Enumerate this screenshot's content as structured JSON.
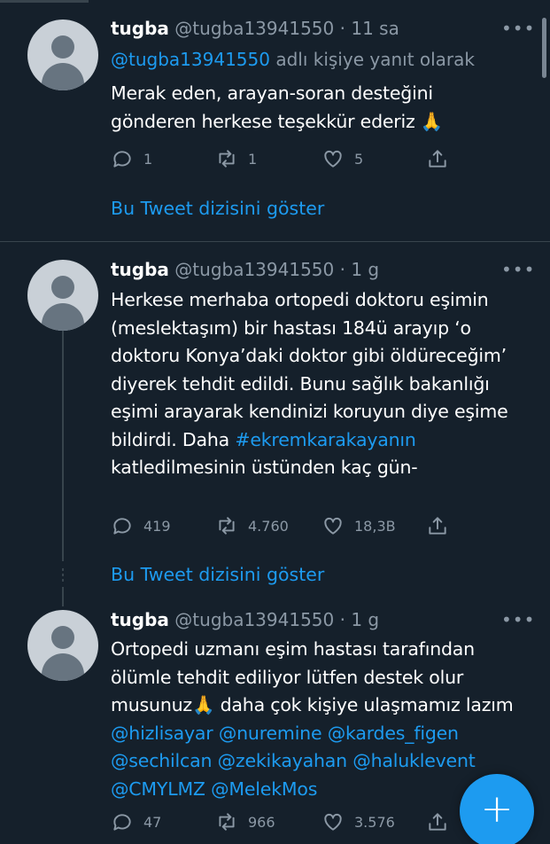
{
  "tweets": [
    {
      "name": "tugba",
      "handle": "@tugba13941550",
      "time": "· 11 sa",
      "reply_handle": "@tugba13941550",
      "reply_suffix": "adlı kişiye yanıt olarak",
      "text_line1": "Merak eden, arayan-soran desteğini",
      "text_line2": "gönderen herkese teşekkür ederiz 🙏",
      "replies": "1",
      "retweets": "1",
      "likes": "5",
      "show_thread": "Bu Tweet dizisini göster"
    },
    {
      "name": "tugba",
      "handle": "@tugba13941550",
      "time": "· 1 g",
      "text_before_hashtag": "Herkese merhaba ortopedi doktoru eşimin (meslektaşım) bir hastası 184ü arayıp ‘o doktoru Konya’daki doktor gibi öldüreceğim’ diyerek tehdit edildi. Bunu sağlık bakanlığı eşimi arayarak kendinizi koruyun diye eşime bildirdi. Daha",
      "hashtag": "#ekremkarakayanın",
      "text_after_hashtag": "katledilmesinin üstünden kaç gün-",
      "replies": "419",
      "retweets": "4.760",
      "likes": "18,3B",
      "show_thread": "Bu Tweet dizisini göster"
    },
    {
      "name": "tugba",
      "handle": "@tugba13941550",
      "time": "· 1 g",
      "text_main": "Ortopedi uzmanı eşim hastası tarafından ölümle tehdit ediliyor lütfen destek olur musunuz🙏 daha çok kişiye ulaşmamız lazım",
      "mentions": [
        "@hizlisayar",
        "@nuremine",
        "@kardes_figen",
        "@sechilcan",
        "@zekikayahan",
        "@haluklevent",
        "@CMYLMZ",
        "@MelekMos"
      ],
      "replies": "47",
      "retweets": "966",
      "likes": "3.576"
    }
  ],
  "icons": {
    "more": "more-horizontal-icon",
    "reply": "reply-bubble-icon",
    "retweet": "retweet-arrows-icon",
    "like": "heart-icon",
    "share": "share-upload-icon",
    "compose": "plus-icon"
  },
  "more_glyph": "•••",
  "compose_glyph": "+",
  "colors": {
    "background": "#15202b",
    "accent": "#1d9bf0",
    "muted": "#8b98a5",
    "divider": "#38444d"
  }
}
